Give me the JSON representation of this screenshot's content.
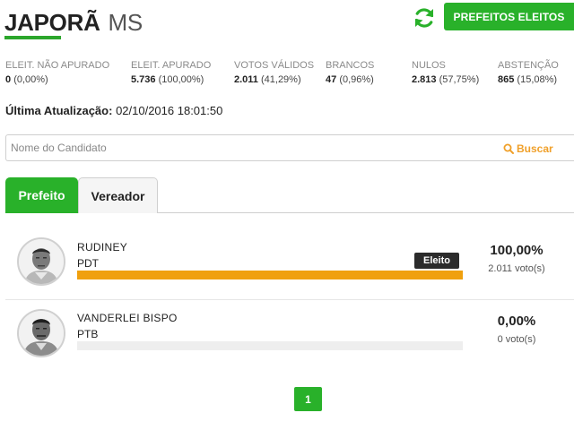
{
  "header": {
    "city": "JAPORÃ",
    "state": "MS",
    "button_label": "PREFEITOS ELEITOS",
    "accent_color": "#29b12a"
  },
  "stats": [
    {
      "label": "ELEIT. NÃO APURADO",
      "value": "0",
      "pct": "(0,00%)"
    },
    {
      "label": "ELEIT. APURADO",
      "value": "5.736",
      "pct": "(100,00%)"
    },
    {
      "label": "VOTOS VÁLIDOS",
      "value": "2.011",
      "pct": "(41,29%)"
    },
    {
      "label": "BRANCOS",
      "value": "47",
      "pct": "(0,96%)"
    },
    {
      "label": "NULOS",
      "value": "2.813",
      "pct": "(57,75%)"
    },
    {
      "label": "ABSTENÇÃO",
      "value": "865",
      "pct": "(15,08%)"
    }
  ],
  "update": {
    "label": "Última Atualização:",
    "value": "02/10/2016 18:01:50"
  },
  "search": {
    "placeholder": "Nome do Candidato",
    "button_label": "Buscar"
  },
  "tabs": [
    {
      "label": "Prefeito",
      "active": true
    },
    {
      "label": "Vereador",
      "active": false
    }
  ],
  "candidates": [
    {
      "name": "RUDINEY",
      "party": "PDT",
      "percent": "100,00%",
      "votes": "2.011 voto(s)",
      "bar_fraction": 1.0,
      "badge": "Eleito"
    },
    {
      "name": "VANDERLEI BISPO",
      "party": "PTB",
      "percent": "0,00%",
      "votes": "0 voto(s)",
      "bar_fraction": 0.0
    }
  ],
  "pagination": {
    "current": "1"
  }
}
